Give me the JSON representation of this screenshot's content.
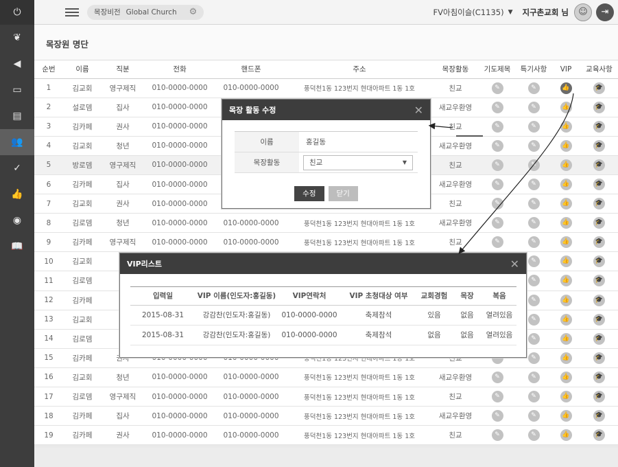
{
  "sidebar": {
    "items": [
      {
        "icon": "power-icon",
        "glyph": "⏻"
      },
      {
        "icon": "leaf-icon",
        "glyph": "❦"
      },
      {
        "icon": "megaphone-icon",
        "glyph": "◀"
      },
      {
        "icon": "calendar-icon",
        "glyph": "▭"
      },
      {
        "icon": "document-icon",
        "glyph": "▤"
      },
      {
        "icon": "users-icon",
        "glyph": "👥"
      },
      {
        "icon": "check-icon",
        "glyph": "✓"
      },
      {
        "icon": "thumbs-up-icon",
        "glyph": "👍"
      },
      {
        "icon": "globe-icon",
        "glyph": "◉"
      },
      {
        "icon": "book-icon",
        "glyph": "📖"
      }
    ]
  },
  "topbar": {
    "site_label": "목장비전",
    "site_name": "Global Church",
    "user_label": "FV아침이슬(C1135)",
    "church_label": "지구촌교회 님"
  },
  "page": {
    "title": "목장원 명단"
  },
  "table": {
    "headers": [
      "순번",
      "이름",
      "직분",
      "전화",
      "핸드폰",
      "주소",
      "목장활동",
      "기도제목",
      "특기사항",
      "VIP",
      "교육사항"
    ],
    "rows": [
      [
        "1",
        "김교회",
        "영구제직",
        "010-0000-0000",
        "010-0000-0000",
        "풍덕천1동 123번지 현대아파트 1동 1호",
        "친교"
      ],
      [
        "2",
        "설로뎀",
        "집사",
        "010-0000-0000",
        "",
        "",
        "새교우환영"
      ],
      [
        "3",
        "김카페",
        "권사",
        "010-0000-0000",
        "",
        "",
        "친교"
      ],
      [
        "4",
        "김교회",
        "청년",
        "010-0000-0000",
        "",
        "",
        "새교우환영"
      ],
      [
        "5",
        "방로뎀",
        "영구제직",
        "010-0000-0000",
        "",
        "",
        "친교"
      ],
      [
        "6",
        "김카페",
        "집사",
        "010-0000-0000",
        "",
        "",
        "새교우환영"
      ],
      [
        "7",
        "김교회",
        "권사",
        "010-0000-0000",
        "",
        "",
        "친교"
      ],
      [
        "8",
        "김로뎀",
        "청년",
        "010-0000-0000",
        "010-0000-0000",
        "풍덕천1동 123번지 현대아파트 1동 1호",
        "새교우환영"
      ],
      [
        "9",
        "김카페",
        "영구제직",
        "010-0000-0000",
        "010-0000-0000",
        "풍덕천1동 123번지 현대아파트 1동 1호",
        "친교"
      ],
      [
        "10",
        "김교회",
        "",
        "",
        "",
        "",
        ""
      ],
      [
        "11",
        "김로뎀",
        "",
        "",
        "",
        "",
        ""
      ],
      [
        "12",
        "김카페",
        "",
        "",
        "",
        "",
        ""
      ],
      [
        "13",
        "김교회",
        "영",
        "",
        "",
        "",
        ""
      ],
      [
        "14",
        "김로뎀",
        "",
        "",
        "",
        "",
        ""
      ],
      [
        "15",
        "김카페",
        "권사",
        "010-0000-0000",
        "010-0000-0000",
        "풍덕천1동 123번지 현대아파트 1동 1호",
        "친교"
      ],
      [
        "16",
        "김교회",
        "청년",
        "010-0000-0000",
        "010-0000-0000",
        "풍덕천1동 123번지 현대아파트 1동 1호",
        "새교우환영"
      ],
      [
        "17",
        "김로뎀",
        "영구제직",
        "010-0000-0000",
        "010-0000-0000",
        "풍덕천1동 123번지 현대아파트 1동 1호",
        "친교"
      ],
      [
        "18",
        "김카페",
        "집사",
        "010-0000-0000",
        "010-0000-0000",
        "풍덕천1동 123번지 현대아파트 1동 1호",
        "새교우환영"
      ],
      [
        "19",
        "김카페",
        "권사",
        "010-0000-0000",
        "010-0000-0000",
        "풍덕천1동 123번지 현대아파트 1동 1호",
        "친교"
      ]
    ],
    "row_icons": {
      "prayer": "pencil-icon",
      "special": "pencil-icon",
      "vip": "thumbs-up-icon",
      "education": "mortarboard-icon"
    }
  },
  "modal_edit": {
    "title": "목장 활동 수정",
    "name_label": "이름",
    "name_value": "홍길동",
    "activity_label": "목장활동",
    "activity_value": "친교",
    "submit_label": "수정",
    "close_label": "닫기"
  },
  "modal_vip": {
    "title": "VIP리스트",
    "headers": [
      "입력일",
      "VIP 이름(인도자:홍길동)",
      "VIP연락처",
      "VIP 초청대상 여부",
      "교회경험",
      "목장",
      "복음"
    ],
    "rows": [
      [
        "2015-08-31",
        "강감찬(인도자:홍길동)",
        "010-0000-0000",
        "축제참석",
        "있음",
        "없음",
        "열려있음"
      ],
      [
        "2015-08-31",
        "강감찬(인도자:홍길동)",
        "010-0000-0000",
        "축제참석",
        "없음",
        "없음",
        "열려있음"
      ]
    ]
  },
  "colors": {
    "sidebar": "#3d3d3d",
    "modal_header": "#3d3d3d",
    "icon_light": "#c2c2c2",
    "icon_dark": "#6a6a6a"
  }
}
